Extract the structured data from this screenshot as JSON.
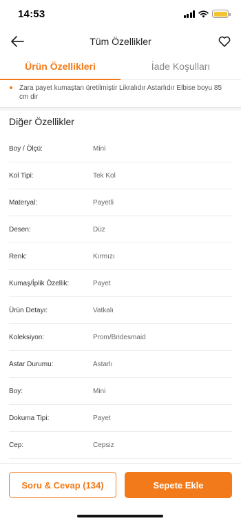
{
  "status_bar": {
    "time": "14:53",
    "icons": [
      "signal-icon",
      "wifi-icon",
      "battery-icon"
    ],
    "battery_color": "#f4c430"
  },
  "nav": {
    "title": "Tüm Özellikler",
    "back_icon": "arrow-left-icon",
    "favorite_icon": "heart-icon"
  },
  "tabs": [
    {
      "label": "Ürün Özellikleri",
      "active": true
    },
    {
      "label": "İade Koşulları",
      "active": false
    }
  ],
  "description": "Zara payet kumaştan üretilmiştir Likralıdır Astarlıdır Elbise boyu 85 cm dir",
  "section_title": "Diğer Özellikler",
  "specs": [
    {
      "key": "Boy / Ölçü:",
      "value": "Mini"
    },
    {
      "key": "Kol Tipi:",
      "value": "Tek Kol"
    },
    {
      "key": "Materyal:",
      "value": "Payetli"
    },
    {
      "key": "Desen:",
      "value": "Düz"
    },
    {
      "key": "Renk:",
      "value": "Kırmızı"
    },
    {
      "key": "Kumaş/İplik Özellik:",
      "value": "Payet"
    },
    {
      "key": "Ürün Detayı:",
      "value": "Vatkalı"
    },
    {
      "key": "Koleksiyon:",
      "value": "Prom/Bridesmaid"
    },
    {
      "key": "Astar Durumu:",
      "value": "Astarlı"
    },
    {
      "key": "Boy:",
      "value": "Mini"
    },
    {
      "key": "Dokuma Tipi:",
      "value": "Payet"
    },
    {
      "key": "Cep:",
      "value": "Cepsiz"
    }
  ],
  "bottom": {
    "qa_label": "Soru & Cevap (134)",
    "cart_label": "Sepete Ekle"
  },
  "colors": {
    "accent": "#f27a1a"
  }
}
